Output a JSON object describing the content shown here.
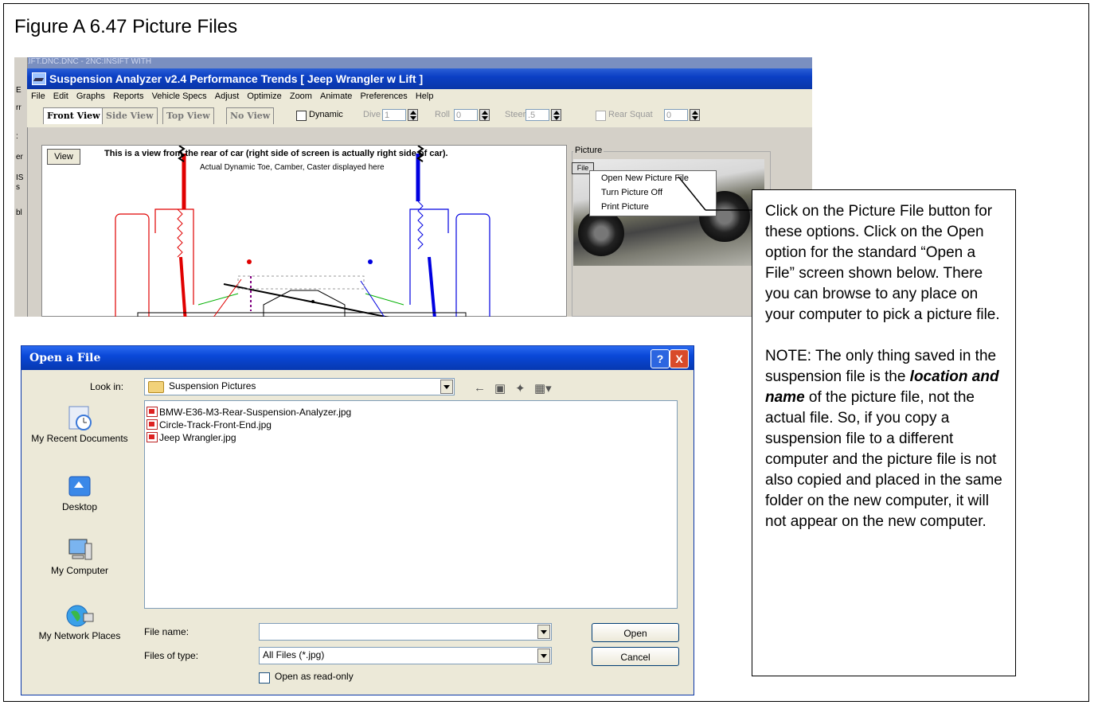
{
  "figure": {
    "title": "Figure A 6.47  Picture Files"
  },
  "suspension_window": {
    "prev_title_fragment": "...LIFT.DNC.DNC - 2NC:INSIFT WITH",
    "left_strip_chars": [
      "E",
      "rr",
      ":",
      "er",
      "IS",
      "s",
      "bl"
    ],
    "title": "Suspension Analyzer v2.4  Performance Trends  [ Jeep Wrangler w Lift ]",
    "menu": [
      "File",
      "Edit",
      "Graphs",
      "Reports",
      "Vehicle Specs",
      "Adjust",
      "Optimize",
      "Zoom",
      "Animate",
      "Preferences",
      "Help"
    ],
    "tabs": [
      "Front View",
      "Side View",
      "Top View",
      "No View"
    ],
    "dynamic_label": "Dynamic",
    "dive_label": "Dive",
    "dive_value": "1",
    "roll_label": "Roll",
    "roll_value": "0",
    "steer_label": "Steer",
    "steer_value": ".5",
    "rear_squat_label": "Rear Squat",
    "rear_squat_value": "0",
    "view_button": "View",
    "canvas_line1": "This is a view from the rear of car (right side of screen is actually right side of car).",
    "canvas_line2": "Actual Dynamic Toe, Camber, Caster displayed here",
    "picture_group_label": "Picture",
    "picture_file_button": "File",
    "popup_menu": [
      "Open New Picture File",
      "Turn Picture Off",
      "Print Picture"
    ]
  },
  "callout": {
    "para1": "Click on the Picture File button for these options.  Click on the Open option for the standard “Open a File” screen shown below.  There you can browse to any place on your computer to pick a picture file.",
    "para2_a": "NOTE:  The only thing saved in the suspension file is the ",
    "para2_em": "location and name",
    "para2_b": " of the picture file, not the actual file. So, if you copy a suspension file to a different computer and the picture file is not also copied and placed in the same folder on the new computer, it will not appear on the new computer."
  },
  "open_dialog": {
    "title": "Open a File",
    "help_button": "?",
    "close_button": "X",
    "look_in_label": "Look in:",
    "look_in_value": "Suspension Pictures",
    "places": [
      "My Recent Documents",
      "Desktop",
      "My Computer",
      "My Network Places"
    ],
    "files": [
      "BMW-E36-M3-Rear-Suspension-Analyzer.jpg",
      "Circle-Track-Front-End.jpg",
      "Jeep Wrangler.jpg"
    ],
    "file_name_label": "File name:",
    "file_name_value": "",
    "files_of_type_label": "Files of type:",
    "files_of_type_value": "All Files (*.jpg)",
    "read_only_label": "Open as read-only",
    "open_button": "Open",
    "cancel_button": "Cancel"
  },
  "colors": {
    "title_bar": "#0a48d8",
    "dialog_bg": "#ece9d8",
    "red_wheel": "#e00000",
    "blue_wheel": "#0000e0"
  }
}
